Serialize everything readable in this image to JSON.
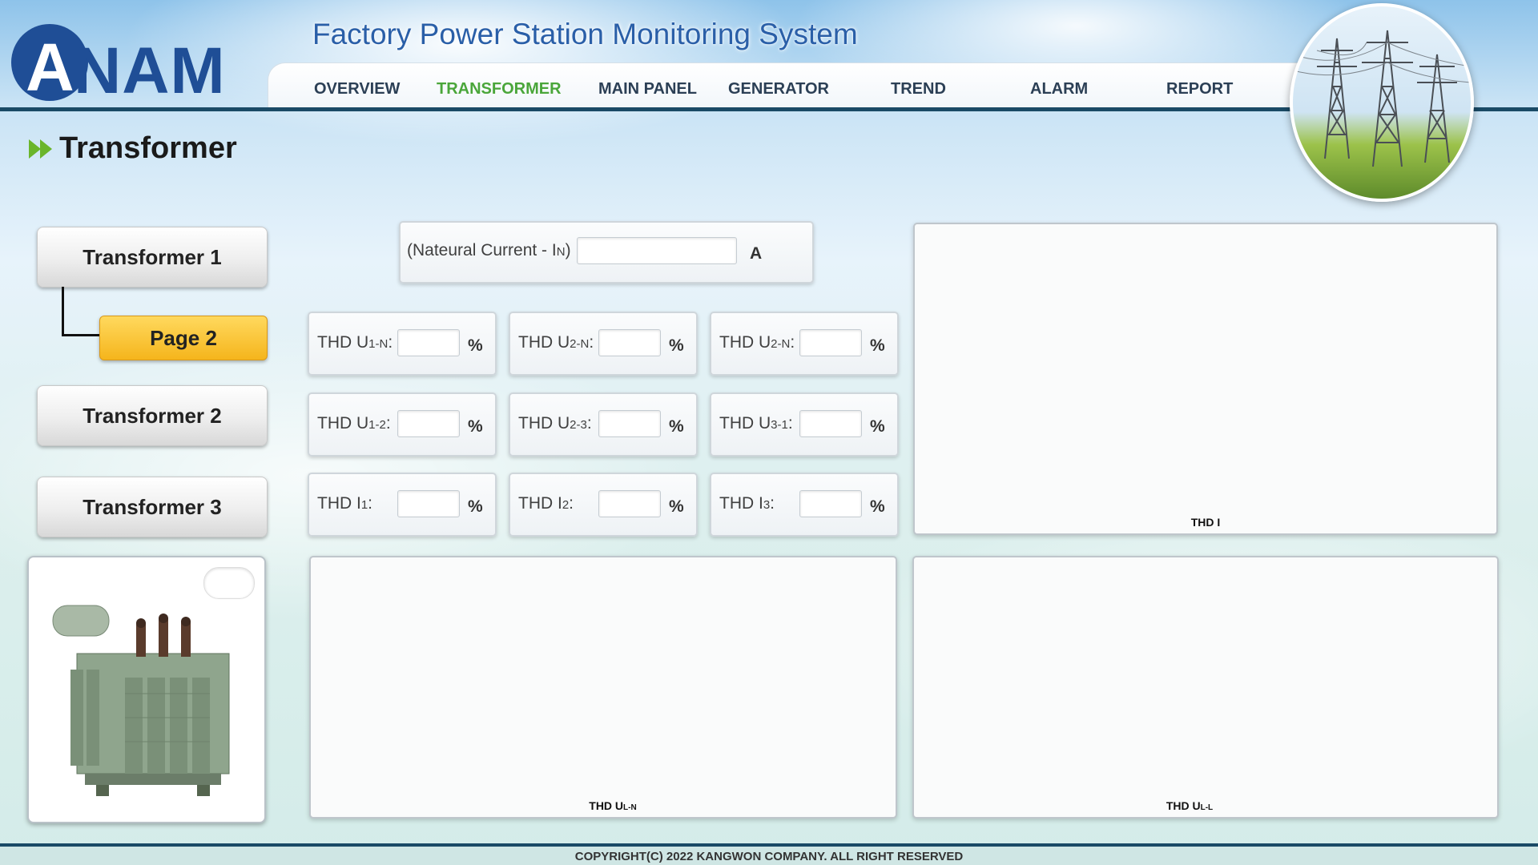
{
  "brand": {
    "logo_letter": "A",
    "logo_text": "NAM"
  },
  "app_title": "Factory Power Station Monitoring System",
  "nav": [
    {
      "label": "OVERVIEW",
      "active": false
    },
    {
      "label": "TRANSFORMER",
      "active": true
    },
    {
      "label": "MAIN PANEL",
      "active": false
    },
    {
      "label": "GENERATOR",
      "active": false
    },
    {
      "label": "TREND",
      "active": false
    },
    {
      "label": "ALARM",
      "active": false
    },
    {
      "label": "REPORT",
      "active": false
    }
  ],
  "page_title": "Transformer",
  "menu": {
    "transformer1": "Transformer 1",
    "page2": "Page 2",
    "transformer2": "Transformer 2",
    "transformer3": "Transformer 3"
  },
  "neutral_current": {
    "label": "(Nateural Current - I",
    "label_sub": "N",
    "label_end": ")",
    "value": "",
    "unit": "A"
  },
  "thd_fields": [
    {
      "id": "u1n",
      "label": "THD U",
      "sub": "1-N",
      "suffix": ":",
      "value": "",
      "unit": "%"
    },
    {
      "id": "u2n_a",
      "label": "THD U",
      "sub": "2-N",
      "suffix": ":",
      "value": "",
      "unit": "%"
    },
    {
      "id": "u2n_b",
      "label": "THD U",
      "sub": "2-N",
      "suffix": ":",
      "value": "",
      "unit": "%"
    },
    {
      "id": "u12",
      "label": "THD U",
      "sub": "1-2",
      "suffix": ":",
      "value": "",
      "unit": "%"
    },
    {
      "id": "u23",
      "label": "THD U",
      "sub": "2-3",
      "suffix": ":",
      "value": "",
      "unit": "%"
    },
    {
      "id": "u31",
      "label": "THD U",
      "sub": "3-1",
      "suffix": ":",
      "value": "",
      "unit": "%"
    },
    {
      "id": "i1",
      "label": "THD I",
      "sub": "1",
      "suffix": ":",
      "value": "",
      "unit": "%"
    },
    {
      "id": "i2",
      "label": "THD I",
      "sub": "2",
      "suffix": ":",
      "value": "",
      "unit": "%"
    },
    {
      "id": "i3",
      "label": "THD I",
      "sub": "3",
      "suffix": ":",
      "value": "",
      "unit": "%"
    }
  ],
  "charts": {
    "thd_i": {
      "label": "THD I",
      "sub": ""
    },
    "thd_uln": {
      "label": "THD U",
      "sub": "L-N"
    },
    "thd_ull": {
      "label": "THD U",
      "sub": "L-L"
    }
  },
  "colors": {
    "brand_blue": "#1f4e96",
    "nav_active": "#4aa63a",
    "header_line": "#1a4a66",
    "page_button": "#f5b51c"
  },
  "footer": "COPYRIGHT(C) 2022 KANGWON COMPANY. ALL RIGHT RESERVED"
}
